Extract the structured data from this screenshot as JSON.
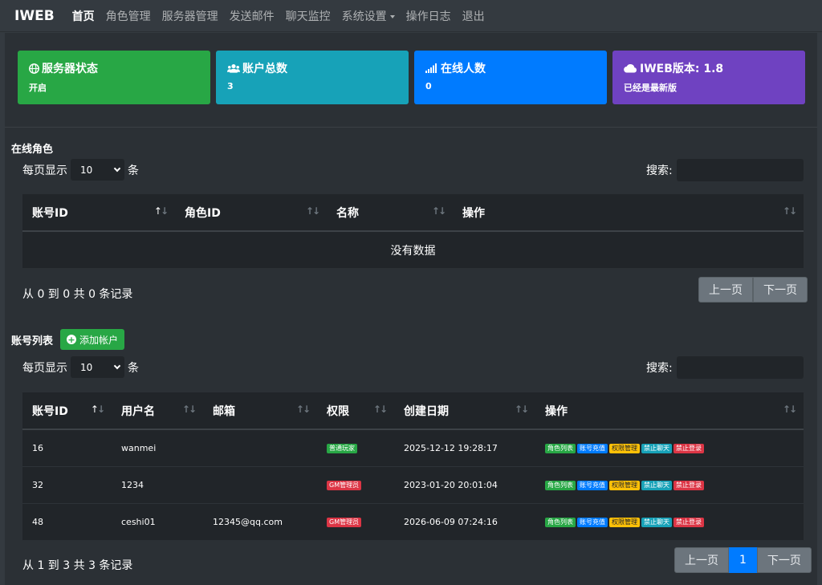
{
  "nav": {
    "brand": "IWEB",
    "items": [
      "首页",
      "角色管理",
      "服务器管理",
      "发送邮件",
      "聊天监控",
      "系统设置",
      "操作日志",
      "退出"
    ]
  },
  "cards": [
    {
      "title": "服务器状态",
      "value": "开启",
      "color": "#28a745",
      "icon": "globe-icon"
    },
    {
      "title": "账户总数",
      "value": "3",
      "color": "#17a2b8",
      "icon": "users-icon"
    },
    {
      "title": "在线人数",
      "value": "0",
      "color": "#007bff",
      "icon": "signal-icon"
    },
    {
      "title": "IWEB版本: 1.8",
      "value": "已经是最新版",
      "color": "#6f42c1",
      "icon": "cloud-icon"
    }
  ],
  "online": {
    "title": "在线角色",
    "length_prefix": "每页显示",
    "length_value": "10",
    "length_suffix": "条",
    "search_label": "搜索:",
    "columns": [
      "账号ID",
      "角色ID",
      "名称",
      "操作"
    ],
    "empty": "没有数据",
    "info": "从 0 到 0 共 0 条记录",
    "prev": "上一页",
    "next": "下一页"
  },
  "accounts": {
    "title": "账号列表",
    "add_label": "添加帐户",
    "length_prefix": "每页显示",
    "length_value": "10",
    "length_suffix": "条",
    "search_label": "搜索:",
    "columns": [
      "账号ID",
      "用户名",
      "邮箱",
      "权限",
      "创建日期",
      "操作"
    ],
    "rows": [
      {
        "id": "16",
        "user": "wanmei",
        "email": "",
        "role": "普通玩家",
        "role_type": "green",
        "date": "2025-12-12 19:28:17"
      },
      {
        "id": "32",
        "user": "1234",
        "email": "",
        "role": "GM管理员",
        "role_type": "red",
        "date": "2023-01-20 20:01:04"
      },
      {
        "id": "48",
        "user": "ceshi01",
        "email": "12345@qq.com",
        "role": "GM管理员",
        "role_type": "red",
        "date": "2026-06-09 07:24:16"
      }
    ],
    "actions": [
      {
        "label": "角色列表",
        "type": "green"
      },
      {
        "label": "账号充值",
        "type": "blue"
      },
      {
        "label": "权限管理",
        "type": "yellow"
      },
      {
        "label": "禁止聊天",
        "type": "teal"
      },
      {
        "label": "禁止登录",
        "type": "red"
      }
    ],
    "info": "从 1 到 3 共 3 条记录",
    "prev": "上一页",
    "page": "1",
    "next": "下一页"
  }
}
